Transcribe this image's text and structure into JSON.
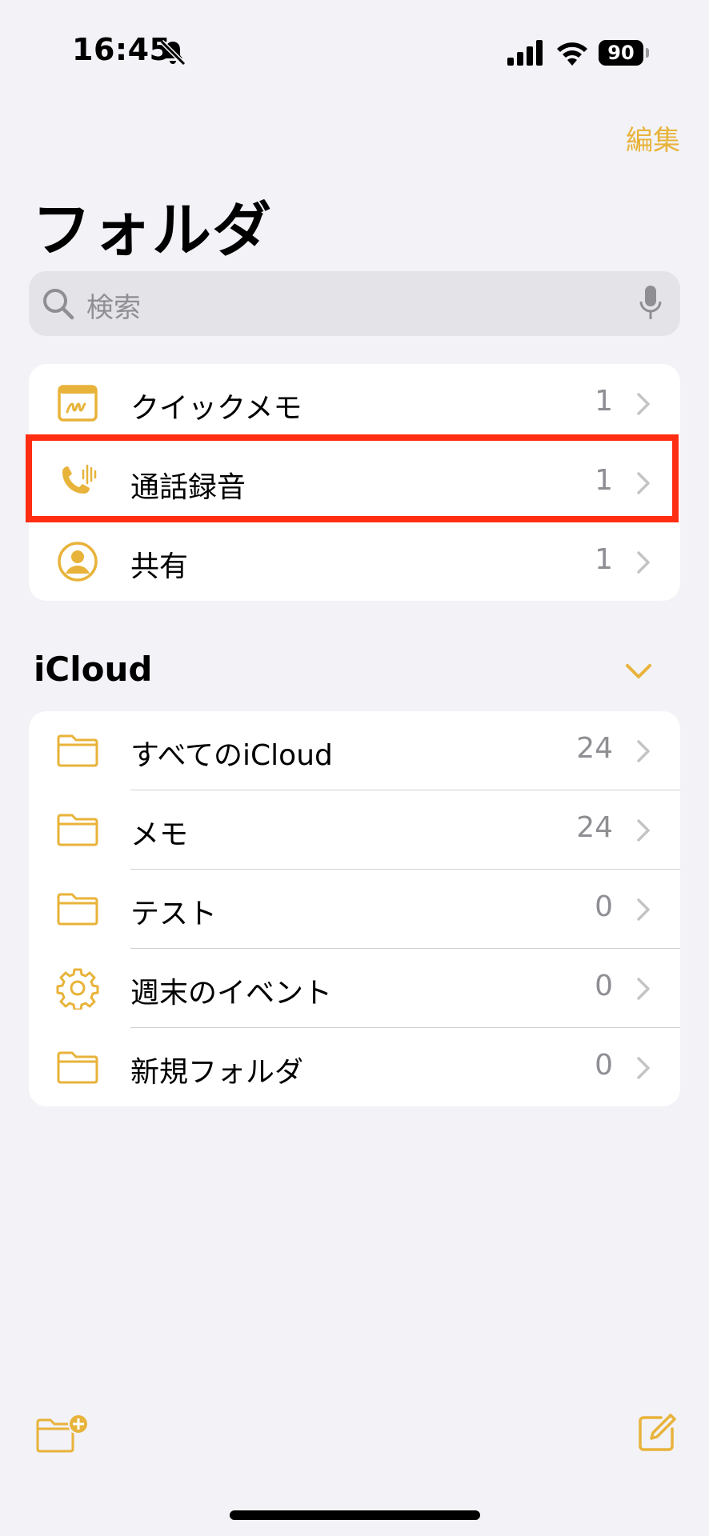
{
  "status_bar": {
    "time": "16:45",
    "battery": "90"
  },
  "nav": {
    "edit_label": "編集",
    "title": "フォルダ"
  },
  "search": {
    "placeholder": "検索"
  },
  "pinned": {
    "items": [
      {
        "label": "クイックメモ",
        "count": "1",
        "icon": "quick-note-icon"
      },
      {
        "label": "通話録音",
        "count": "1",
        "icon": "phone-recording-icon"
      },
      {
        "label": "共有",
        "count": "1",
        "icon": "shared-person-icon"
      }
    ]
  },
  "icloud": {
    "title": "iCloud",
    "items": [
      {
        "label": "すべてのiCloud",
        "count": "24",
        "icon": "folder-icon"
      },
      {
        "label": "メモ",
        "count": "24",
        "icon": "folder-icon"
      },
      {
        "label": "テスト",
        "count": "0",
        "icon": "folder-icon"
      },
      {
        "label": "週末のイベント",
        "count": "0",
        "icon": "gear-icon"
      },
      {
        "label": "新規フォルダ",
        "count": "0",
        "icon": "folder-icon"
      }
    ]
  },
  "colors": {
    "accent": "#E8B33A",
    "highlight": "#FF2D12",
    "background": "#F2F2F7"
  }
}
